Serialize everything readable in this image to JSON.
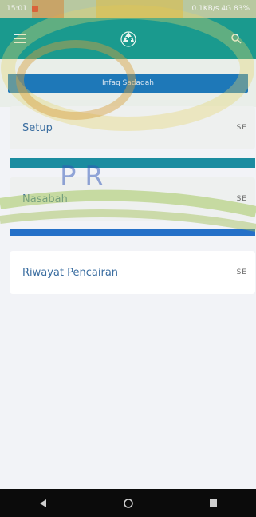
{
  "statusbar": {
    "left_text": "15:01",
    "right_text": "0.1KB/s 4G 83%"
  },
  "appbar": {
    "menu_icon": "menu-icon",
    "logo_icon": "recycle-icon",
    "search_icon": "search-icon"
  },
  "hero": {
    "band_text": "Infaq Sadaqah"
  },
  "cards": [
    {
      "label": "Setup",
      "badge": "SE"
    },
    {
      "label": "Nasabah",
      "badge": "SE"
    },
    {
      "label": "Riwayat Pencairan",
      "badge": "SE"
    }
  ],
  "watermark": {
    "letters": "P R"
  },
  "navbar": {
    "back_icon": "back-triangle-icon",
    "home_icon": "home-circle-icon",
    "recents_icon": "recents-square-icon"
  },
  "colors": {
    "appbar": "#1a9a8e",
    "band": "#1e78b8",
    "label": "#3a6da0",
    "background": "#f2f3f7"
  }
}
